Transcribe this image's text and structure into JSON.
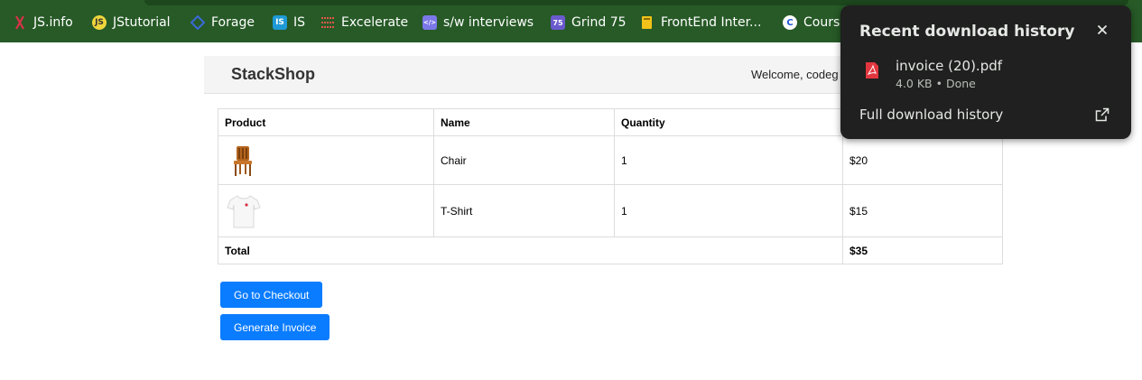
{
  "bookmarks": [
    {
      "label": "JS.info",
      "icon": "js-info-icon"
    },
    {
      "label": "JStutorial",
      "icon": "js-icon"
    },
    {
      "label": "Forage",
      "icon": "forage-icon"
    },
    {
      "label": "IS",
      "icon": "is-icon"
    },
    {
      "label": "Excelerate",
      "icon": "excelerate-icon"
    },
    {
      "label": "s/w interviews",
      "icon": "code-icon"
    },
    {
      "label": "Grind 75",
      "icon": "grind-icon"
    },
    {
      "label": "FrontEnd Inter...",
      "icon": "book-icon"
    },
    {
      "label": "Cours",
      "icon": "course-icon"
    }
  ],
  "bookmark_glyphs": {
    "js": "JS",
    "is": "IS",
    "code": "</>",
    "grind": "75",
    "course": "C"
  },
  "header": {
    "brand": "StackShop",
    "welcome": "Welcome, codeg"
  },
  "cart": {
    "columns": [
      "Product",
      "Name",
      "Quantity",
      ""
    ],
    "rows": [
      {
        "image": "chair-image",
        "name": "Chair",
        "quantity": "1",
        "price": "$20"
      },
      {
        "image": "tshirt-image",
        "name": "T-Shirt",
        "quantity": "1",
        "price": "$15"
      }
    ],
    "total_label": "Total",
    "total_value": "$35"
  },
  "buttons": {
    "checkout": "Go to Checkout",
    "invoice": "Generate Invoice"
  },
  "download_popup": {
    "title": "Recent download history",
    "close_icon": "close-icon",
    "item": {
      "filename": "invoice (20).pdf",
      "meta": "4.0 KB • Done",
      "icon": "pdf-icon"
    },
    "full_history_label": "Full download history",
    "open_icon": "open-external-icon"
  },
  "colors": {
    "bookmarks_bar": "#275a27",
    "primary_button": "#0a7cff",
    "popup_bg": "#1f201f",
    "pdf_red": "#e2363f"
  }
}
